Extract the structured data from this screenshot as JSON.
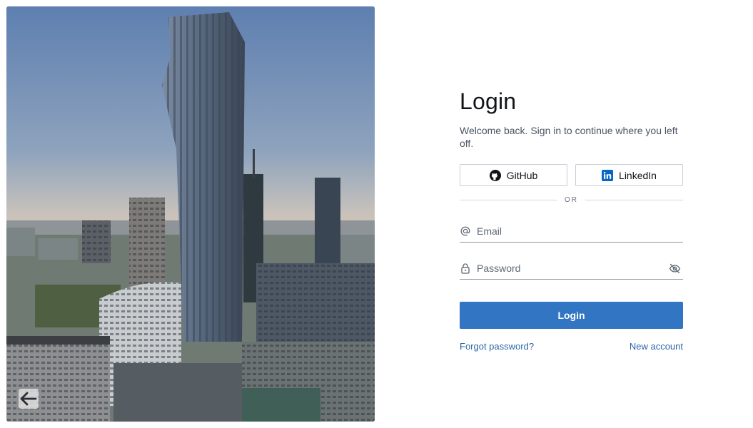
{
  "hero": {
    "back_icon": "arrow-left-icon",
    "colors": {
      "sky_top": "#5e7fb0",
      "sky_bottom": "#d9c5ae",
      "tower": "#4a5a6e"
    }
  },
  "login": {
    "title": "Login",
    "subtitle": "Welcome back. Sign in to continue where you left off.",
    "github_label": "GitHub",
    "github_icon": "github-icon",
    "linkedin_label": "LinkedIn",
    "linkedin_icon": "linkedin-icon",
    "divider_text": "OR",
    "email_placeholder": "Email",
    "email_icon": "at-sign-icon",
    "password_placeholder": "Password",
    "password_icon": "lock-icon",
    "password_toggle_icon": "eye-off-icon",
    "submit_label": "Login",
    "forgot_label": "Forgot password?",
    "new_account_label": "New account",
    "colors": {
      "primary": "#3275c2",
      "link": "#2c66a8",
      "linkedin": "#0a66c2"
    }
  }
}
